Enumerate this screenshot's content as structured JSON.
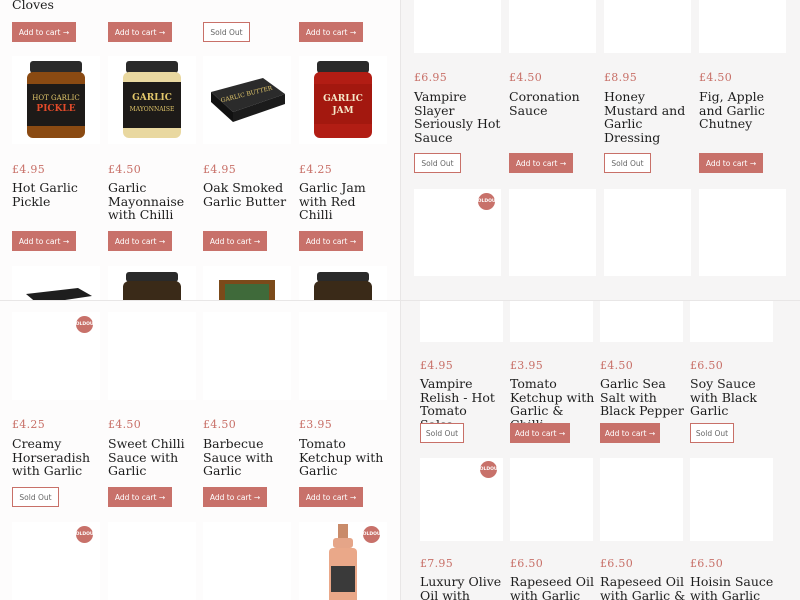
{
  "labels": {
    "add_to_cart": "Add to cart →",
    "sold_out": "Sold Out",
    "badge_line1": "SOLD",
    "badge_line2": "OUT"
  },
  "panel_tl": {
    "top_title_fragment": "Cloves",
    "row1_buttons": [
      "add",
      "add",
      "sold",
      "add"
    ],
    "products": [
      {
        "price": "£4.95",
        "title": "Hot Garlic Pickle",
        "button": "add",
        "image": "hot-garlic-pickle-jar",
        "jar_text": "HOT GARLIC PICKLE"
      },
      {
        "price": "£4.50",
        "title": "Garlic Mayonnaise with Chilli",
        "button": "add",
        "image": "garlic-mayonnaise-jar",
        "jar_text": "GARLIC MAYONNAISE"
      },
      {
        "price": "£4.95",
        "title": "Oak Smoked Garlic Butter",
        "button": "add",
        "image": "garlic-butter-box",
        "jar_text": "GARLIC BUTTER"
      },
      {
        "price": "£4.25",
        "title": "Garlic Jam with Red Chilli",
        "button": "add",
        "image": "garlic-jam-jar",
        "jar_text": "GARLIC JAM"
      }
    ]
  },
  "panel_tr": {
    "products_row1": [
      {
        "price": "£6.95",
        "title": "Vampire Slayer Seriously Hot Sauce",
        "button": "sold"
      },
      {
        "price": "£4.50",
        "title": "Coronation Sauce",
        "button": "add"
      },
      {
        "price": "£8.95",
        "title": "Honey Mustard and Garlic Dressing",
        "button": "sold"
      },
      {
        "price": "£4.50",
        "title": "Fig, Apple and Garlic Chutney",
        "button": "add"
      }
    ]
  },
  "panel_bl": {
    "products_row1": [
      {
        "price": "£4.25",
        "title": "Creamy Horseradish with Garlic",
        "button": "sold",
        "sold_badge": true
      },
      {
        "price": "£4.50",
        "title": "Sweet Chilli Sauce with Garlic",
        "button": "add",
        "sold_badge": false
      },
      {
        "price": "£4.50",
        "title": "Barbecue Sauce with Garlic",
        "button": "add",
        "sold_badge": false
      },
      {
        "price": "£3.95",
        "title": "Tomato Ketchup with Garlic",
        "button": "add",
        "sold_badge": false
      }
    ]
  },
  "panel_br": {
    "products_row1": [
      {
        "price": "£4.95",
        "title": "Vampire Relish - Hot Tomato Salsa",
        "button": "sold"
      },
      {
        "price": "£3.95",
        "title": "Tomato Ketchup with Garlic & Chilli",
        "button": "add"
      },
      {
        "price": "£4.50",
        "title": "Garlic Sea Salt with Black Pepper",
        "button": "add"
      },
      {
        "price": "£6.50",
        "title": "Soy Sauce with Black Garlic",
        "button": "sold"
      }
    ],
    "products_row2": [
      {
        "price": "£7.95",
        "title": "Luxury Olive Oil with"
      },
      {
        "price": "£6.50",
        "title": "Rapeseed Oil with Garlic"
      },
      {
        "price": "£6.50",
        "title": "Rapeseed Oil with Garlic &"
      },
      {
        "price": "£6.50",
        "title": "Hoisin Sauce with Garlic"
      }
    ]
  },
  "colors": {
    "accent": "#c8716a",
    "price": "#c87068",
    "background": "#fdfcfc"
  }
}
